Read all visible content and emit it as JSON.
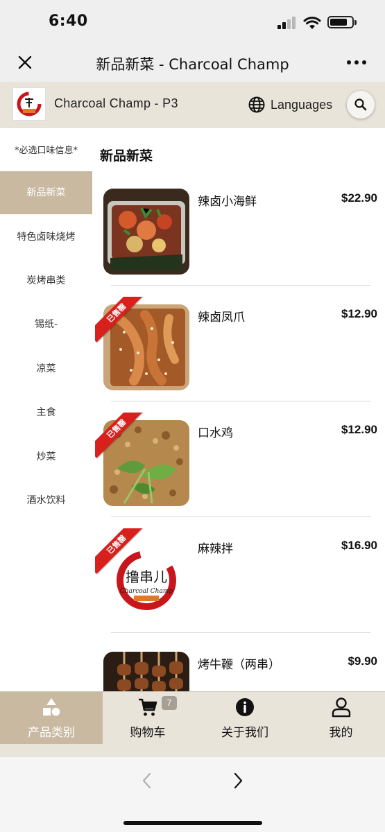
{
  "status_bar": {
    "time": "6:40"
  },
  "title_bar": {
    "title": "新品新菜 - Charcoal Champ"
  },
  "store": {
    "name": "Charcoal Champ - P3",
    "languages_label": "Languages"
  },
  "sidebar": {
    "note": "*必选口味信息*",
    "items": [
      {
        "label": "新品新菜",
        "active": true
      },
      {
        "label": "特色卤味烧烤"
      },
      {
        "label": "炭烤串类"
      },
      {
        "label": "锡纸-"
      },
      {
        "label": "凉菜"
      },
      {
        "label": "主食"
      },
      {
        "label": "炒菜"
      },
      {
        "label": "酒水饮料"
      }
    ]
  },
  "section": {
    "title": "新品新菜"
  },
  "menu_items": [
    {
      "name": "辣卤小海鲜",
      "price": "$22.90"
    },
    {
      "name": "辣卤凤爪",
      "price": "$12.90",
      "badge": "已售罄"
    },
    {
      "name": "口水鸡",
      "price": "$12.90",
      "badge": "已售罄"
    },
    {
      "name": "麻辣拌",
      "price": "$16.90",
      "badge": "已售罄"
    },
    {
      "name": "烤牛鞭（两串）",
      "price": "$9.90"
    }
  ],
  "logo_text": {
    "chinese": "撸串儿",
    "english": "Charcoal Champ"
  },
  "tabbar": {
    "tabs": [
      {
        "label": "产品类别",
        "icon": "categories-icon",
        "active": true
      },
      {
        "label": "购物车",
        "icon": "cart-icon"
      },
      {
        "label": "关于我们",
        "icon": "info-icon"
      },
      {
        "label": "我的",
        "icon": "user-icon"
      }
    ],
    "cart_count": "7"
  },
  "colors": {
    "accent": "#c9b9a1",
    "header_bg": "#e9e4da",
    "soldout_red": "#d8201d"
  }
}
